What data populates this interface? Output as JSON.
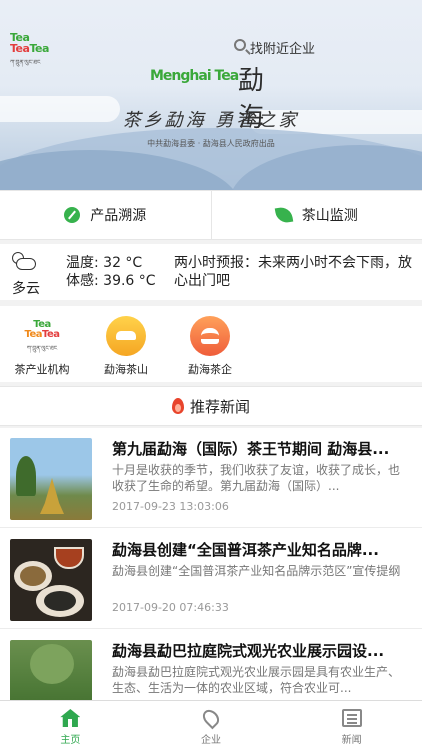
{
  "header": {
    "logo_text": [
      "Tea",
      "Tea",
      "Tea"
    ],
    "logo_subtext": "ཀ་བྲུན་ལུང་ཐང",
    "search_placeholder": "找附近企业",
    "brand_logo": {
      "latin": "Menghai Tea",
      "chinese": "勐海"
    },
    "slogan": "茶乡勐海 勇者之家",
    "org": "中共勐海县委 · 勐海县人民政府出品"
  },
  "actions": [
    {
      "label": "产品溯源",
      "icon": "pen-icon"
    },
    {
      "label": "茶山监测",
      "icon": "leaf-icon"
    }
  ],
  "weather": {
    "condition": "多云",
    "temperature": "温度:  32 °C",
    "feels_like": "体感:  39.6 °C",
    "forecast": "两小时预报：未来两小时不会下雨，放心出门吧"
  },
  "categories": [
    {
      "label": "茶产业机构",
      "icon": "tea-logo-icon"
    },
    {
      "label": "勐海茶山",
      "icon": "car-icon"
    },
    {
      "label": "勐海茶企",
      "icon": "burger-icon"
    }
  ],
  "news_section": {
    "title": "推荐新闻"
  },
  "news": [
    {
      "title": "第九届勐海（国际）茶王节期间 勐海县...",
      "summary": "十月是收获的季节，我们收获了友谊，收获了成长，也收获了生命的希望。第九届勐海（国际）...",
      "date": "2017-09-23 13:03:06"
    },
    {
      "title": "勐海县创建“全国普洱茶产业知名品牌...",
      "summary": "勐海县创建“全国普洱茶产业知名品牌示范区”宣传提纲",
      "date": "2017-09-20 07:46:33"
    },
    {
      "title": "勐海县勐巴拉庭院式观光农业展示园设...",
      "summary": "勐海县勐巴拉庭院式观光农业展示园是具有农业生产、生态、生活为一体的农业区域，符合农业可...",
      "date": ""
    }
  ],
  "tabbar": [
    {
      "label": "主页",
      "icon": "home-icon",
      "active": true
    },
    {
      "label": "企业",
      "icon": "location-pin-icon",
      "active": false
    },
    {
      "label": "新闻",
      "icon": "newspaper-icon",
      "active": false
    }
  ],
  "colors": {
    "accent": "#2fa84f",
    "yellow": "#f5a623",
    "orange": "#ef5d3a",
    "flame": "#e8442c"
  }
}
